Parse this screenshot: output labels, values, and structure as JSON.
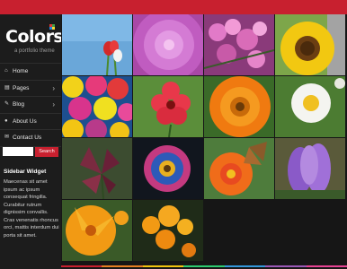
{
  "site": {
    "logo_text": "Colorsy",
    "tagline": "a portfolio theme"
  },
  "menu": [
    {
      "label": "Home",
      "icon": "home-icon",
      "glyph": "⌂",
      "chevron": ""
    },
    {
      "label": "Pages",
      "icon": "pages-icon",
      "glyph": "▤",
      "chevron": "›"
    },
    {
      "label": "Blog",
      "icon": "blog-icon",
      "glyph": "✎",
      "chevron": "›"
    },
    {
      "label": "About Us",
      "icon": "user-icon",
      "glyph": "●",
      "chevron": ""
    },
    {
      "label": "Contact Us",
      "icon": "mail-icon",
      "glyph": "✉",
      "chevron": ""
    }
  ],
  "search": {
    "button_label": "Search",
    "value": ""
  },
  "widget": {
    "title": "Sidebar Widget",
    "text": "Maecenas sit amet ipsum ac ipsum consequat fringilla. Curabitur rutrum dignissim convallis. Cras venenatis rhoncus orci, mattis interdum dui porta sit amet."
  },
  "gallery": [
    {
      "name": "red-tulips",
      "bg": "#6ea8d8"
    },
    {
      "name": "pink-dahlia",
      "bg": "#b84fb1"
    },
    {
      "name": "pink-blossoms",
      "bg": "#7a2f6e"
    },
    {
      "name": "sunflower",
      "bg": "#6e9a3c"
    },
    {
      "name": "colorful-daisies",
      "bg": "#d23a78"
    },
    {
      "name": "red-flower",
      "bg": "#5a8a3a"
    },
    {
      "name": "orange-gerbera",
      "bg": "#3c6e2c"
    },
    {
      "name": "white-daisy",
      "bg": "#4a7a30"
    },
    {
      "name": "dark-lily",
      "bg": "#3a4a30"
    },
    {
      "name": "pink-aster",
      "bg": "#141a22"
    },
    {
      "name": "butterfly-flower",
      "bg": "#4c7a3a"
    },
    {
      "name": "purple-crocus",
      "bg": "#5a4c80"
    },
    {
      "name": "orange-lily",
      "bg": "#3a5a28"
    },
    {
      "name": "orange-flowers",
      "bg": "#1f2b18"
    }
  ],
  "colors": {
    "accent": "#c8202f",
    "logo_dots": [
      "#e53935",
      "#43a047",
      "#1e88e5",
      "#fdd835"
    ],
    "bottom_stripe": [
      "#c8202f",
      "#e67e22",
      "#f1c40f",
      "#2ecc71",
      "#3498db",
      "#9b59b6",
      "#e84393"
    ]
  }
}
